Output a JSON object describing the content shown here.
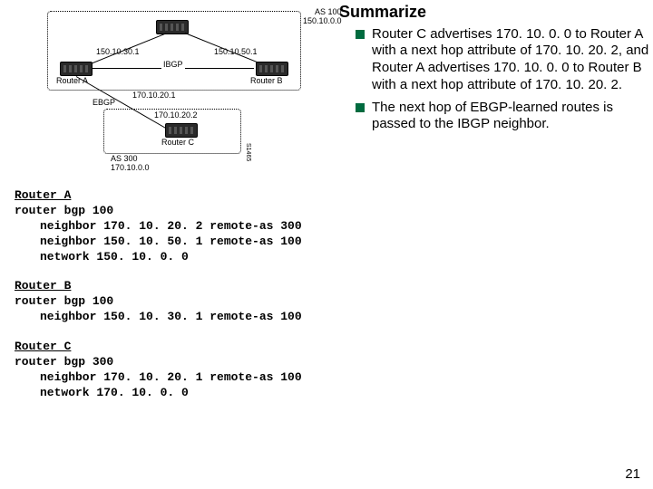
{
  "summary": {
    "title": "Summarize",
    "bullets": [
      "Router C advertises 170. 10. 0. 0 to Router A with a next hop attribute of 170. 10. 20. 2, and Router A advertises 170. 10. 0. 0 to Router B with a next hop attribute of 170. 10. 20. 2.",
      "The next hop of EBGP-learned routes is passed to the IBGP neighbor."
    ]
  },
  "diagram": {
    "as100_label_l1": "AS 100",
    "as100_label_l2": "150.10.0.0",
    "routerA_name": "Router A",
    "routerB_name": "Router B",
    "routerC_name": "Router C",
    "ip_a_top": "150.10.30.1",
    "ip_b_top": "150.10.50.1",
    "ibgp": "IBGP",
    "ebgp": "EBGP",
    "ip_a_down": "170.10.20.1",
    "ip_c_up": "170.10.20.2",
    "as300_label_l1": "AS 300",
    "as300_label_l2": "170.10.0.0",
    "fig_id": "S1465"
  },
  "configs": {
    "A": {
      "title": "Router A",
      "l1": "router bgp 100",
      "l2": "neighbor 170. 10. 20. 2 remote-as 300",
      "l3": "neighbor 150. 10. 50. 1 remote-as 100",
      "l4": "network 150. 10. 0. 0"
    },
    "B": {
      "title": "Router B",
      "l1": "router bgp 100",
      "l2": "neighbor 150. 10. 30. 1 remote-as 100"
    },
    "C": {
      "title": "Router C",
      "l1": "router bgp 300",
      "l2": "neighbor 170. 10. 20. 1 remote-as 100",
      "l3": "network 170. 10. 0. 0"
    }
  },
  "page_number": "21"
}
